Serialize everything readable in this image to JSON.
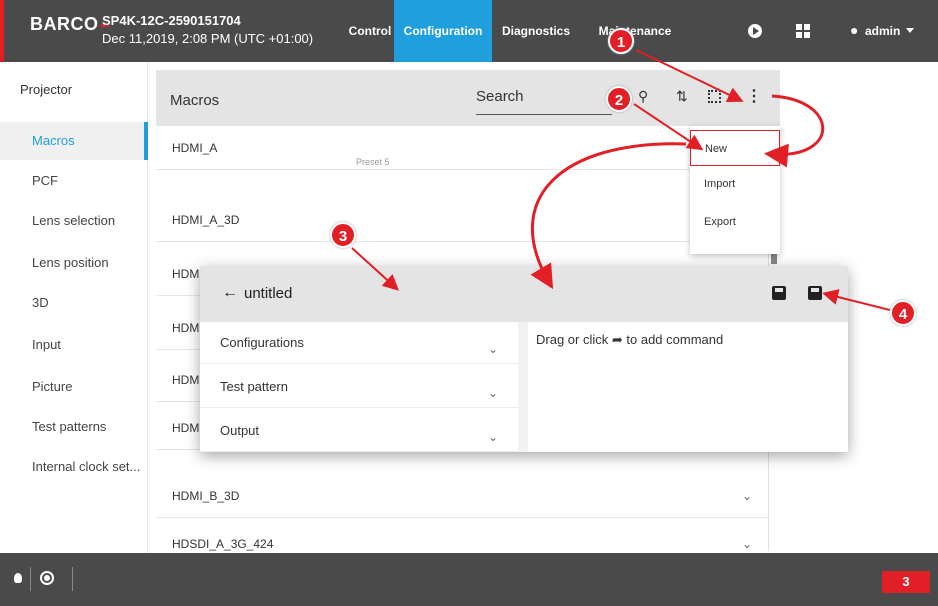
{
  "header": {
    "logo": "BARCO",
    "device_name": "SP4K-12C-2590151704",
    "device_time": "Dec 11,2019, 2:08 PM (UTC +01:00)",
    "nav": [
      "Control",
      "Configuration",
      "Diagnostics",
      "Maintenance"
    ],
    "active_nav": "Configuration",
    "user": "admin",
    "accent_color": "#1f9fdd"
  },
  "sidebar": {
    "title": "Projector",
    "items": [
      {
        "label": "Macros",
        "active": true
      },
      {
        "label": "PCF"
      },
      {
        "label": "Lens selection"
      },
      {
        "label": "Lens position"
      },
      {
        "label": "3D"
      },
      {
        "label": "Input"
      },
      {
        "label": "Picture"
      },
      {
        "label": "Test patterns"
      },
      {
        "label": "Internal clock set..."
      }
    ]
  },
  "macros": {
    "title": "Macros",
    "search_placeholder": "Search",
    "rows": [
      {
        "name": "HDMI_A",
        "sub": "Preset 5"
      },
      {
        "name": "HDMI_A_3D",
        "sub": ""
      },
      {
        "name": "HDM",
        "sub": ""
      },
      {
        "name": "HDM",
        "sub": ""
      },
      {
        "name": "HDM",
        "sub": ""
      },
      {
        "name": "HDM",
        "sub": ""
      },
      {
        "name": "HDMI_B_3D",
        "sub": ""
      },
      {
        "name": "HDSDI_A_3G_424",
        "sub": ""
      }
    ]
  },
  "menu": {
    "items": [
      "New",
      "Import",
      "Export"
    ]
  },
  "dialog": {
    "title": "untitled",
    "sections": [
      "Configurations",
      "Test pattern",
      "Output"
    ],
    "hint_before": "Drag or click",
    "hint_after": "to add command"
  },
  "callouts": [
    "1",
    "2",
    "3",
    "4"
  ],
  "footer": {
    "alert_count": "3",
    "alert_color": "#e21e26"
  }
}
